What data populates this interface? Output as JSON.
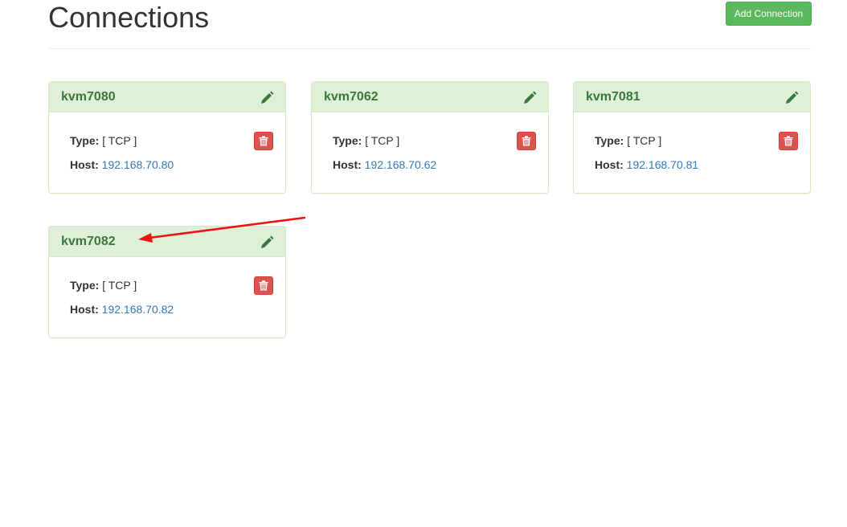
{
  "page": {
    "title": "Connections",
    "add_button_label": "Add Connection"
  },
  "labels": {
    "type": "Type:",
    "host": "Host:"
  },
  "connections": [
    {
      "name": "kvm7080",
      "type": "[ TCP ]",
      "host": "192.168.70.80"
    },
    {
      "name": "kvm7062",
      "type": "[ TCP ]",
      "host": "192.168.70.62"
    },
    {
      "name": "kvm7081",
      "type": "[ TCP ]",
      "host": "192.168.70.81"
    },
    {
      "name": "kvm7082",
      "type": "[ TCP ]",
      "host": "192.168.70.82"
    }
  ],
  "colors": {
    "success": "#5cb85c",
    "panel_heading": "#dff0d8",
    "panel_title": "#3c763d",
    "danger": "#d9534f",
    "link": "#337ab7",
    "annotation_arrow": "#ee1111"
  },
  "icons": {
    "edit": "pencil-icon",
    "delete": "trash-icon"
  }
}
